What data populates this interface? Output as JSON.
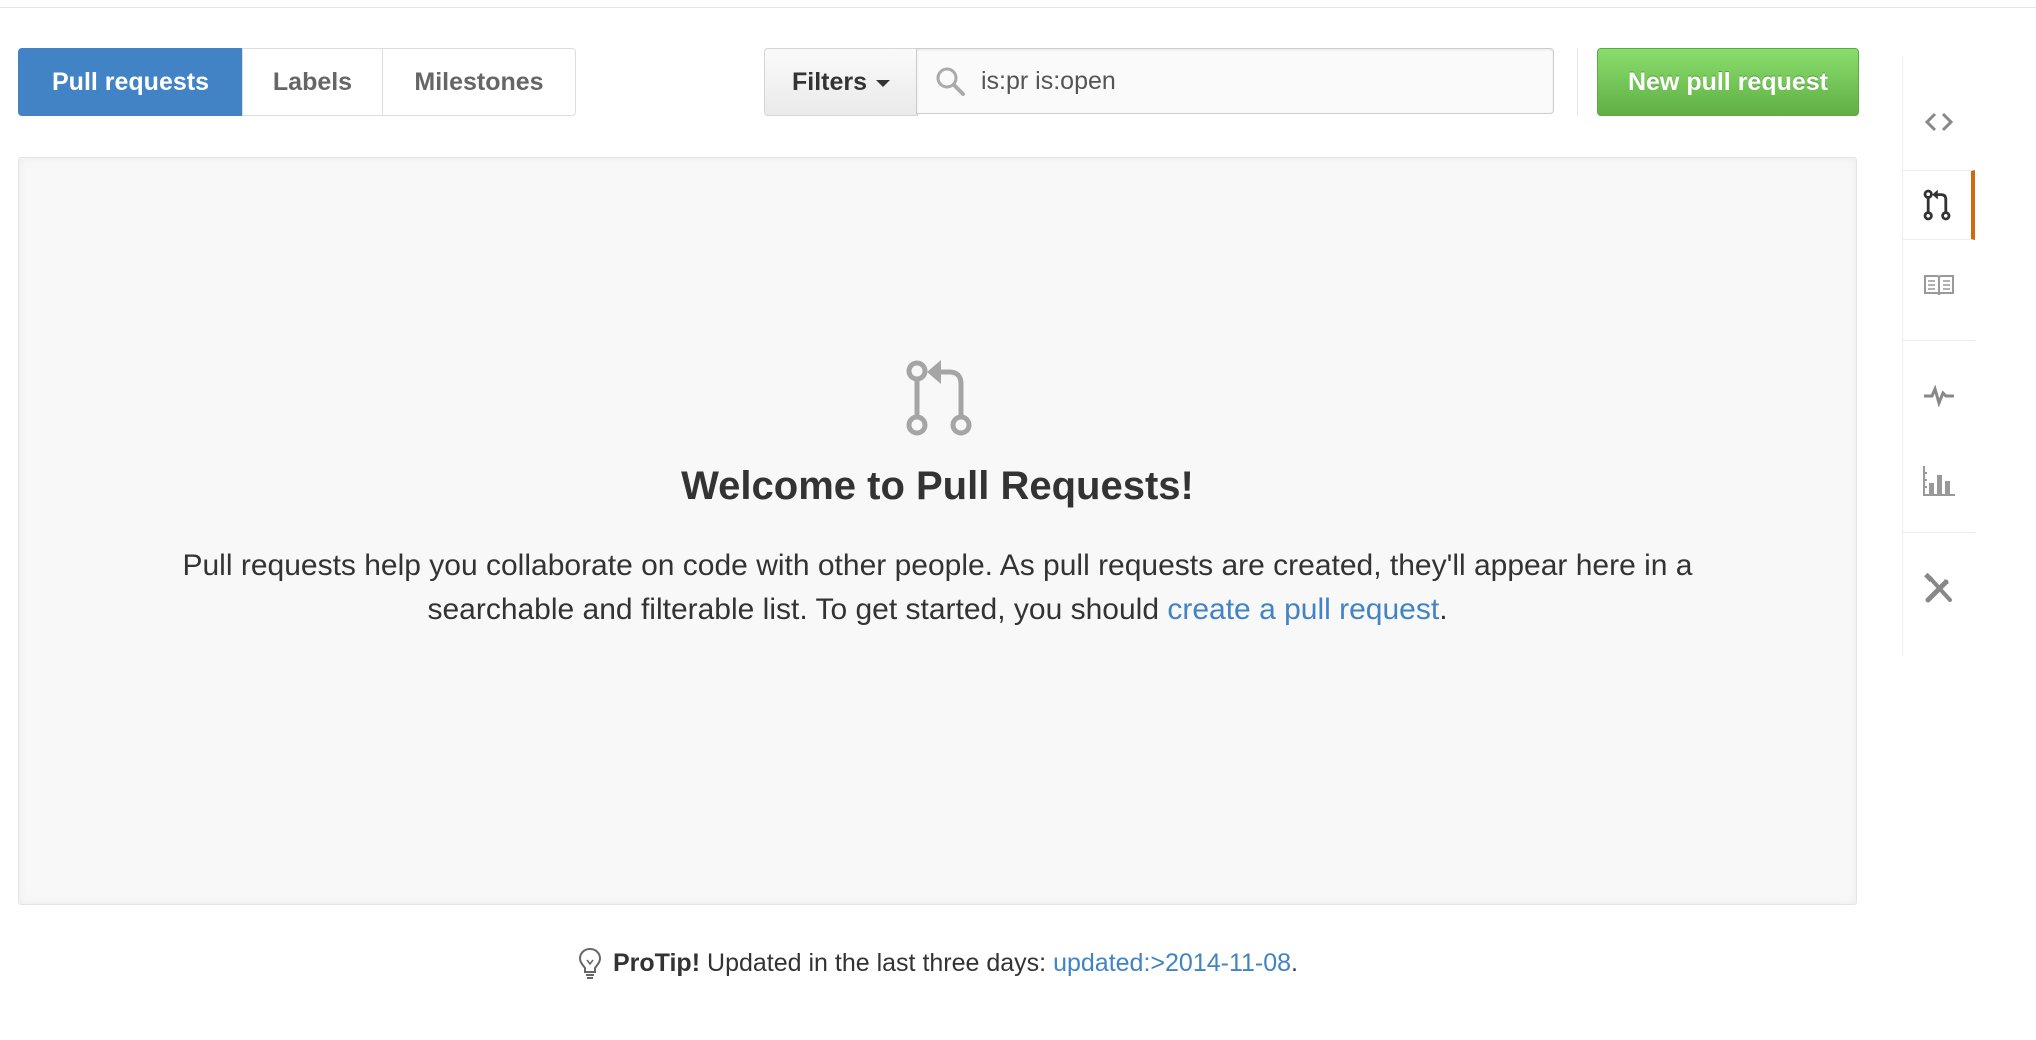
{
  "subnav": {
    "tabs": [
      {
        "label": "Pull requests",
        "selected": true
      },
      {
        "label": "Labels",
        "selected": false
      },
      {
        "label": "Milestones",
        "selected": false
      }
    ]
  },
  "filters": {
    "label": "Filters",
    "search_value": "is:pr is:open"
  },
  "new_pull_request_label": "New pull request",
  "blankslate": {
    "title": "Welcome to Pull Requests!",
    "text_before_link": "Pull requests help you collaborate on code with other people. As pull requests are created, they'll appear here in a searchable and filterable list. To get started, you should ",
    "link_text": "create a pull request",
    "text_after_link": "."
  },
  "protip": {
    "label": "ProTip!",
    "text": "Updated in the last three days:",
    "link_text": "updated:>2014-11-08",
    "suffix": "."
  },
  "repo_nav": {
    "items": [
      {
        "icon": "code-icon",
        "selected": false
      },
      {
        "icon": "git-pull-request-icon",
        "selected": true
      },
      {
        "icon": "book-icon",
        "selected": false
      },
      {
        "icon": "pulse-icon",
        "selected": false
      },
      {
        "icon": "graph-icon",
        "selected": false
      },
      {
        "icon": "tools-icon",
        "selected": false
      }
    ]
  },
  "colors": {
    "accent_blue": "#4183c4",
    "button_green": "#6cc644",
    "selected_nav_orange": "#d26911",
    "icon_gray": "#999999"
  }
}
